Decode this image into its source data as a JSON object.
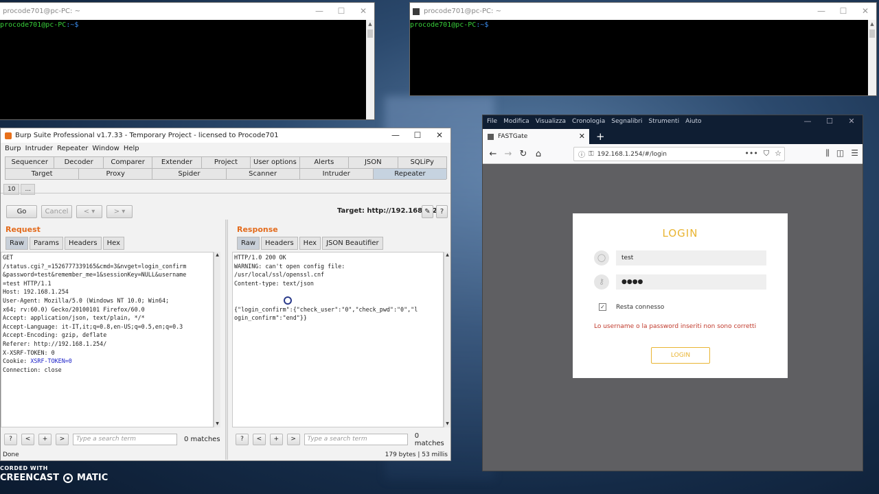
{
  "terminals": [
    {
      "title": "procode701@pc-PC: ~",
      "prompt_user": "procode701@pc-PC",
      "prompt_path": ":~$"
    },
    {
      "title": "procode701@pc-PC: ~",
      "prompt_user": "procode701@pc-PC",
      "prompt_path": ":~$"
    }
  ],
  "burp": {
    "title": "Burp Suite Professional v1.7.33 - Temporary Project - licensed to Procode701",
    "menu": [
      "Burp",
      "Intruder",
      "Repeater",
      "Window",
      "Help"
    ],
    "tabs_row1": [
      "Sequencer",
      "Decoder",
      "Comparer",
      "Extender",
      "Project options",
      "User options",
      "Alerts",
      "JSON Beautifier",
      "SQLiPy"
    ],
    "tabs_row2": [
      "Target",
      "Proxy",
      "Spider",
      "Scanner",
      "Intruder",
      "Repeater"
    ],
    "repeater_tabs": [
      "10",
      "..."
    ],
    "go": "Go",
    "cancel": "Cancel",
    "back": "<",
    "forward": ">",
    "dropdown": "▾",
    "target": "Target: http://192.168.1.254",
    "request_title": "Request",
    "response_title": "Response",
    "request_tabs": [
      "Raw",
      "Params",
      "Headers",
      "Hex"
    ],
    "response_tabs": [
      "Raw",
      "Headers",
      "Hex",
      "JSON Beautifier"
    ],
    "request_text_before": "GET\n/status.cgi?_=1526777339165&cmd=3&nvget=login_confirm\n&password=test&remember_me=1&sessionKey=NULL&username\n=test HTTP/1.1\nHost: 192.168.1.254\nUser-Agent: Mozilla/5.0 (Windows NT 10.0; Win64;\nx64; rv:60.0) Gecko/20100101 Firefox/60.0\nAccept: application/json, text/plain, */*\nAccept-Language: it-IT,it;q=0.8,en-US;q=0.5,en;q=0.3\nAccept-Encoding: gzip, deflate\nReferer: http://192.168.1.254/\nX-XSRF-TOKEN: 0\nCookie: ",
    "request_cookie": "XSRF-TOKEN=0",
    "request_text_after": "\nConnection: close",
    "response_text": "HTTP/1.0 200 OK\nWARNING: can't open config file:\n/usr/local/ssl/openssl.cnf\nContent-type: text/json\n\n\n{\"login_confirm\":{\"check_user\":\"0\",\"check_pwd\":\"0\",\"l\nogin_confirm\":\"end\"}}",
    "search_placeholder": "Type a search term",
    "matches": "0 matches",
    "help": "?",
    "prev": "<",
    "add": "+",
    "next": ">",
    "status_left": "Done",
    "status_right": "179 bytes | 53 millis"
  },
  "firefox": {
    "menu": [
      "File",
      "Modifica",
      "Visualizza",
      "Cronologia",
      "Segnalibri",
      "Strumenti",
      "Aiuto"
    ],
    "tab_title": "FASTGate",
    "url": "192.168.1.254/#/login",
    "login": {
      "title": "LOGIN",
      "username": "test",
      "password": "●●●●",
      "remember_label": "Resta connesso",
      "remember_checked": true,
      "error": "Lo username o la password inseriti non sono corretti",
      "button": "LOGIN"
    }
  },
  "watermark": {
    "line1": "CORDED WITH",
    "line2_left": "CREENCAST",
    "line2_right": "MATIC"
  }
}
